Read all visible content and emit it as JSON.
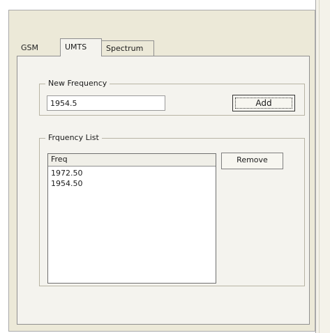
{
  "tabs": [
    {
      "label": "GSM",
      "active": false
    },
    {
      "label": "UMTS",
      "active": true
    },
    {
      "label": "Spectrum",
      "active": false
    }
  ],
  "new_frequency": {
    "group_label": "New Frequency",
    "input_value": "1954.5",
    "add_button_label": "Add"
  },
  "frequency_list": {
    "group_label": "Frquency List",
    "column_header": "Freq",
    "rows": [
      "1972.50",
      "1954.50"
    ],
    "remove_button_label": "Remove"
  }
}
